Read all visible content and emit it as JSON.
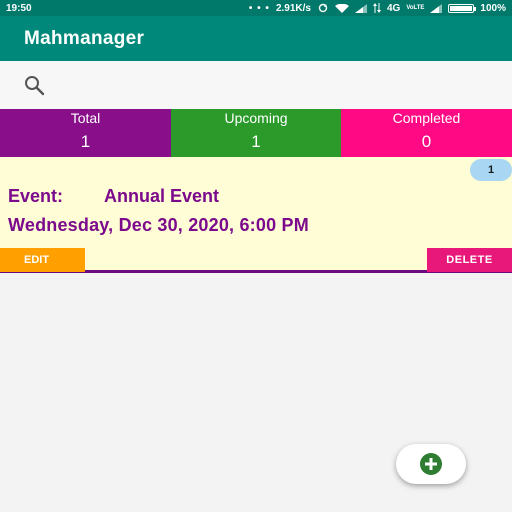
{
  "status_bar": {
    "time": "19:50",
    "dots": "• • •",
    "net_speed": "2.91K/s",
    "network": "4G",
    "volte": "VoLTE",
    "battery": "100%",
    "battery_level": 1.0
  },
  "app": {
    "title": "Mahmanager"
  },
  "search": {
    "placeholder": ""
  },
  "stats": [
    {
      "label": "Total",
      "value": "1",
      "color": "#880e8a"
    },
    {
      "label": "Upcoming",
      "value": "1",
      "color": "#2b9a2b"
    },
    {
      "label": "Completed",
      "value": "0",
      "color": "#ff0a84"
    }
  ],
  "event": {
    "badge": "1",
    "label": "Event:",
    "name": "Annual Event",
    "datetime": "Wednesday, Dec 30, 2020, 6:00 PM",
    "edit_label": "EDIT",
    "delete_label": "DELETE"
  },
  "fab": {
    "icon": "add-circle-icon",
    "color": "#2e7d32"
  }
}
